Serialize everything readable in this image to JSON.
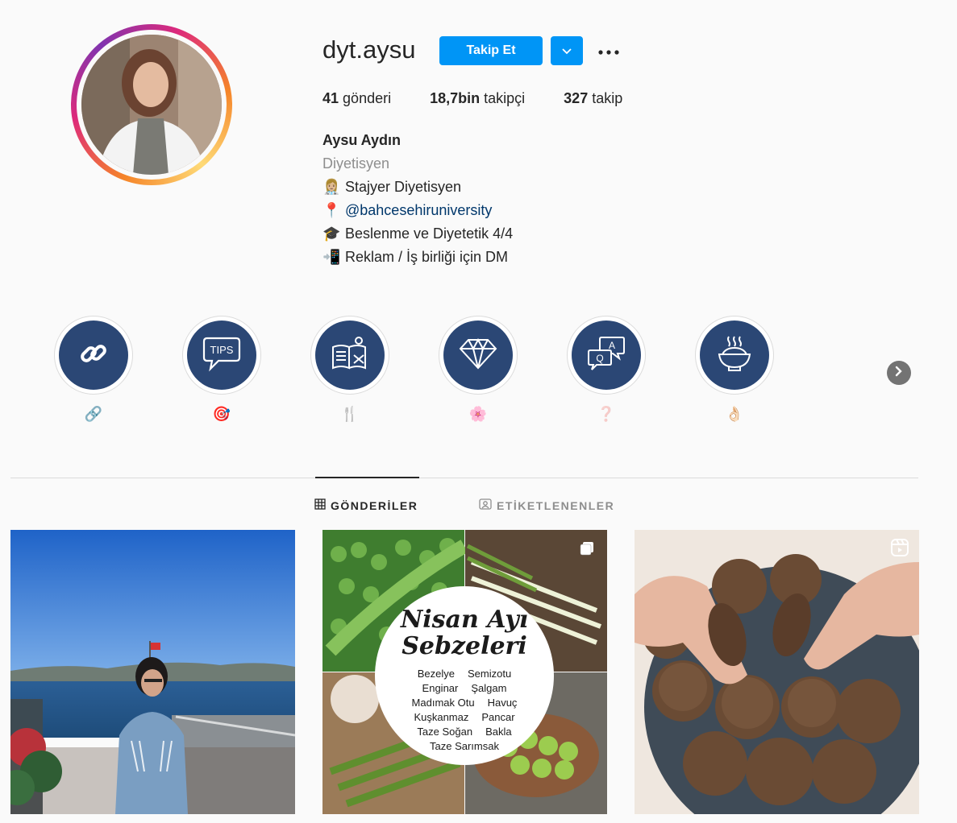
{
  "profile": {
    "username": "dyt.aysu",
    "follow_label": "Takip Et",
    "stats": {
      "posts_count": "41",
      "posts_label": "gönderi",
      "followers_count": "18,7bin",
      "followers_label": "takipçi",
      "following_count": "327",
      "following_label": "takip"
    },
    "bio": {
      "name": "Aysu Aydın",
      "category": "Diyetisyen",
      "lines": [
        {
          "emoji": "👩🏼‍⚕️",
          "text": "Stajyer Diyetisyen"
        },
        {
          "emoji": "📍",
          "text": "@bahcesehiruniversity"
        },
        {
          "emoji": "🎓",
          "text": "Beslenme ve Diyetetik 4/4"
        },
        {
          "emoji": "📲",
          "text": "Reklam / İş birliği için DM"
        }
      ]
    }
  },
  "highlights": [
    {
      "icon": "link-icon",
      "label": "🔗"
    },
    {
      "icon": "tips-bubble-icon",
      "label": "🎯"
    },
    {
      "icon": "recipe-book-icon",
      "label": "🍴"
    },
    {
      "icon": "diamond-icon",
      "label": "🌸"
    },
    {
      "icon": "qa-bubble-icon",
      "label": "❓"
    },
    {
      "icon": "food-bowl-icon",
      "label": "👌🏻"
    }
  ],
  "tabs": [
    {
      "label": "GÖNDERİLER",
      "icon": "grid-icon",
      "active": true
    },
    {
      "label": "ETİKETLENENLER",
      "icon": "tagged-icon",
      "active": false
    }
  ],
  "posts": {
    "vegetables": {
      "title_line1": "Nisan Ayı",
      "title_line2": "Sebzeleri",
      "rows": [
        [
          "Bezelye",
          "Semizotu"
        ],
        [
          "Enginar",
          "Şalgam"
        ],
        [
          "Madımak Otu",
          "Havuç"
        ],
        [
          "Kuşkanmaz",
          "Pancar"
        ],
        [
          "Taze Soğan",
          "Bakla"
        ],
        [
          "Taze Sarımsak"
        ]
      ]
    }
  },
  "colors": {
    "accent": "#0095f6",
    "highlight_bg": "#2b4775",
    "link": "#00376b",
    "muted": "#8e8e8e"
  }
}
